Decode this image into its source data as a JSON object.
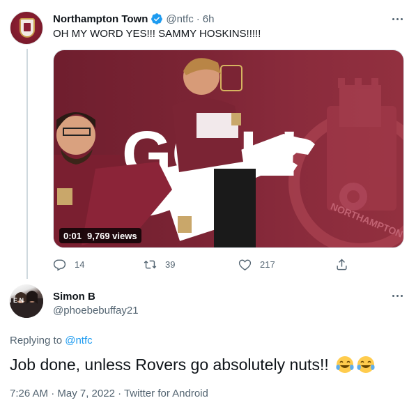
{
  "parent_tweet": {
    "display_name": "Northampton Town",
    "handle": "@ntfc",
    "separator": "·",
    "time": "6h",
    "text": "OH MY WORD YES!!! SAMMY HOSKINS!!!!!",
    "media": {
      "video_time": "0:01",
      "views": "9,769 views",
      "overlay_text": "GO L!",
      "crest_text": "NORTHAMPTON TOWN F.C."
    },
    "actions": {
      "replies": "14",
      "retweets": "39",
      "likes": "217"
    }
  },
  "reply_tweet": {
    "display_name": "Simon B",
    "handle": "@phoebebuffay21",
    "replying_prefix": "Replying to",
    "replying_to": "@ntfc",
    "text": "Job done, unless Rovers go absolutely nuts!!",
    "meta": "7:26 AM · May 7, 2022 · Twitter for Android"
  },
  "colors": {
    "accent": "#1d9bf0",
    "muted": "#536471",
    "club_claret": "#7b2434"
  },
  "icons": {
    "verified": "verified-badge-icon",
    "more": "more-icon",
    "reply": "reply-icon",
    "retweet": "retweet-icon",
    "like": "like-icon",
    "share": "share-icon",
    "emoji": "face-with-tears-of-joy"
  }
}
